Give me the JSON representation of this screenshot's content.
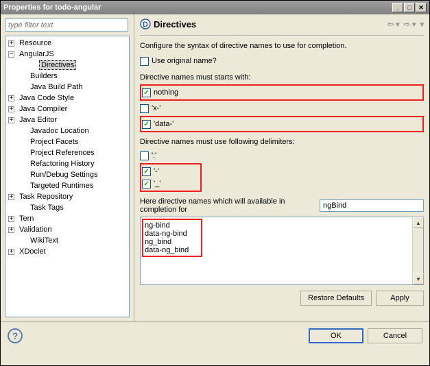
{
  "window": {
    "title": "Properties for todo-angular"
  },
  "filter": {
    "placeholder": "type filter text"
  },
  "tree": [
    {
      "label": "Resource",
      "indent": 0,
      "exp": "+"
    },
    {
      "label": "AngularJS",
      "indent": 0,
      "exp": "−"
    },
    {
      "label": "Directives",
      "indent": 2,
      "exp": "",
      "selected": true
    },
    {
      "label": "Builders",
      "indent": 1,
      "exp": ""
    },
    {
      "label": "Java Build Path",
      "indent": 1,
      "exp": ""
    },
    {
      "label": "Java Code Style",
      "indent": 0,
      "exp": "+"
    },
    {
      "label": "Java Compiler",
      "indent": 0,
      "exp": "+"
    },
    {
      "label": "Java Editor",
      "indent": 0,
      "exp": "+"
    },
    {
      "label": "Javadoc Location",
      "indent": 1,
      "exp": ""
    },
    {
      "label": "Project Facets",
      "indent": 1,
      "exp": ""
    },
    {
      "label": "Project References",
      "indent": 1,
      "exp": ""
    },
    {
      "label": "Refactoring History",
      "indent": 1,
      "exp": ""
    },
    {
      "label": "Run/Debug Settings",
      "indent": 1,
      "exp": ""
    },
    {
      "label": "Targeted Runtimes",
      "indent": 1,
      "exp": ""
    },
    {
      "label": "Task Repository",
      "indent": 0,
      "exp": "+"
    },
    {
      "label": "Task Tags",
      "indent": 1,
      "exp": ""
    },
    {
      "label": "Tern",
      "indent": 0,
      "exp": "+"
    },
    {
      "label": "Validation",
      "indent": 0,
      "exp": "+"
    },
    {
      "label": "WikiText",
      "indent": 1,
      "exp": ""
    },
    {
      "label": "XDoclet",
      "indent": 0,
      "exp": "+"
    }
  ],
  "page": {
    "title": "Directives",
    "desc": "Configure the syntax of directive names to use for completion.",
    "useOriginal": {
      "label": "Use original name?",
      "checked": false
    },
    "startsWithLabel": "Directive names must starts with:",
    "startsWith": [
      {
        "label": "nothing",
        "checked": true,
        "highlight": true
      },
      {
        "label": "'x-'",
        "checked": false,
        "highlight": false
      },
      {
        "label": "'data-'",
        "checked": true,
        "highlight": true
      }
    ],
    "delimitersLabel": "Directive names must use following delimiters:",
    "delimiters": [
      {
        "label": "':'",
        "checked": false,
        "highlight": false
      },
      {
        "label": "'-'",
        "checked": true,
        "highlight": true
      },
      {
        "label": "'_'",
        "checked": true,
        "highlight": true
      }
    ],
    "completionLabel": "Here directive names which will available in completion for",
    "completionInput": "ngBind",
    "results": [
      "ng-bind",
      "data-ng-bind",
      "ng_bind",
      "data-ng_bind"
    ]
  },
  "buttons": {
    "restoreDefaults": "Restore Defaults",
    "apply": "Apply",
    "ok": "OK",
    "cancel": "Cancel"
  }
}
